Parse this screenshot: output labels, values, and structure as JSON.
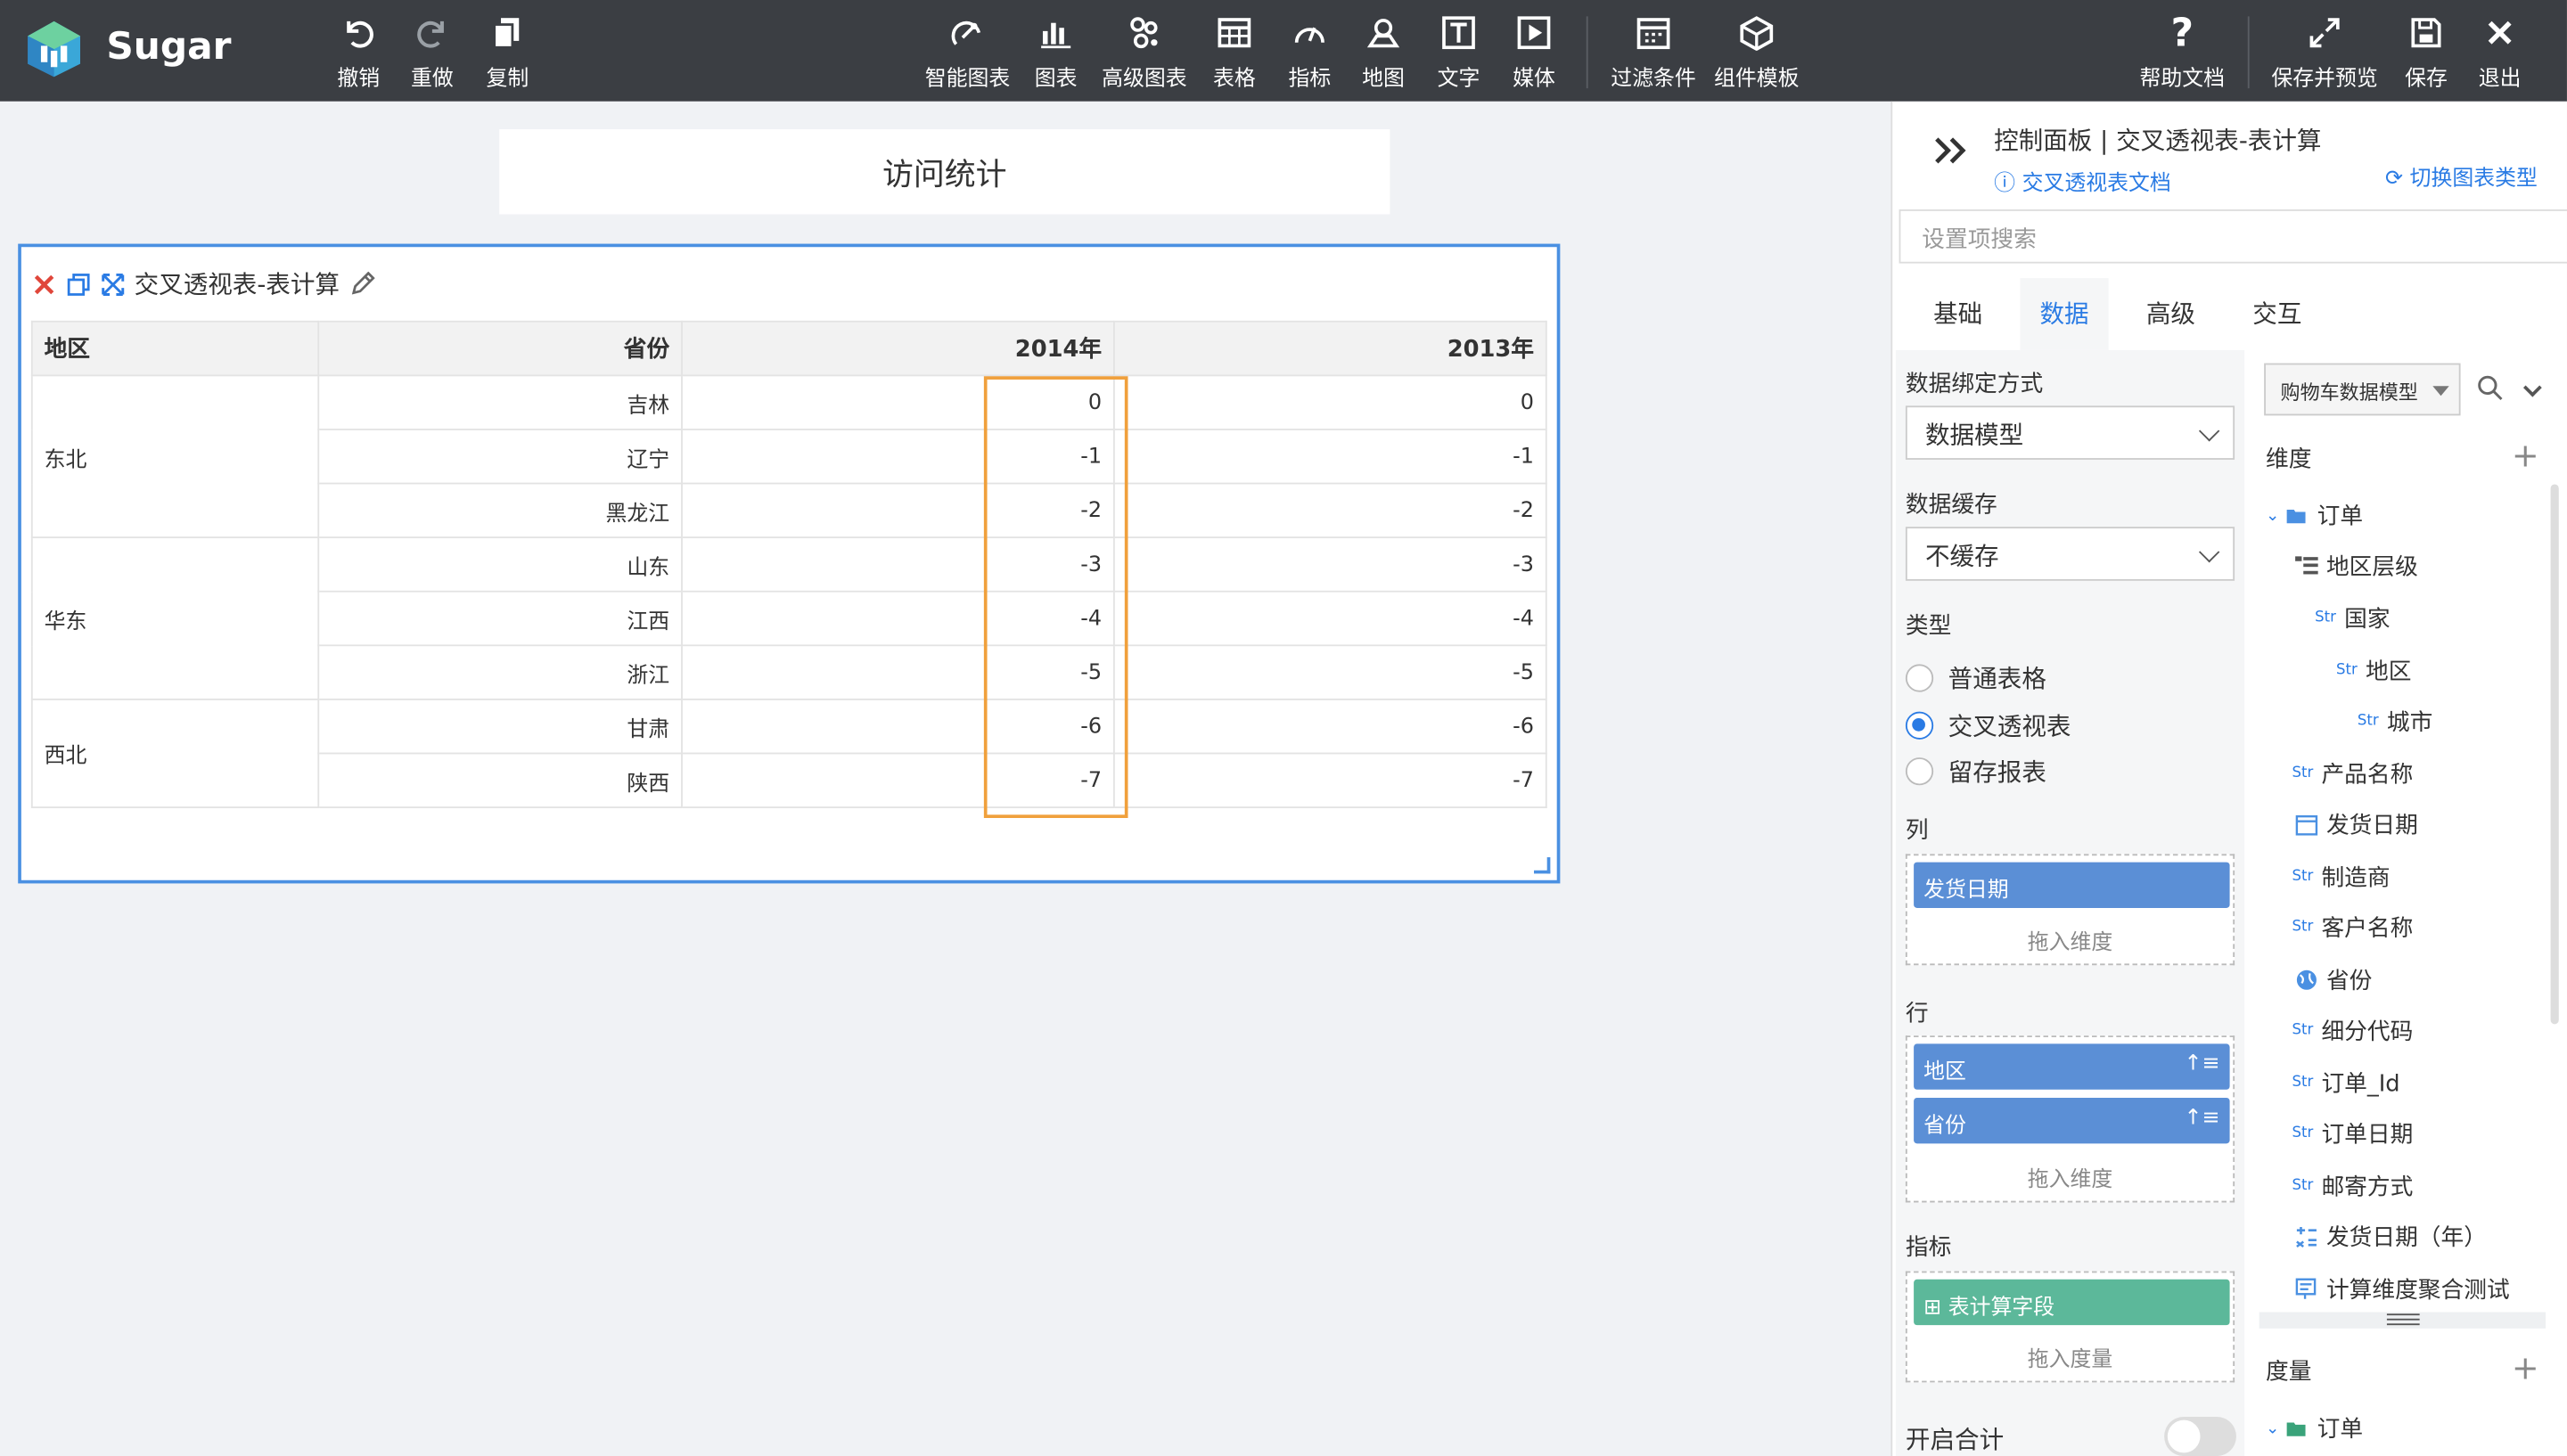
{
  "app": {
    "name": "Sugar"
  },
  "toolbar": {
    "undo": "撤销",
    "redo": "重做",
    "copy": "复制",
    "smart_chart": "智能图表",
    "chart": "图表",
    "adv_chart": "高级图表",
    "table": "表格",
    "indicator": "指标",
    "map": "地图",
    "text": "文字",
    "media": "媒体",
    "filter": "过滤条件",
    "template": "组件模板",
    "help": "帮助文档",
    "save_preview": "保存并预览",
    "save": "保存",
    "exit": "退出"
  },
  "canvas": {
    "page_title": "访问统计",
    "widget": {
      "title": "交叉透视表-表计算",
      "headers": [
        "地区",
        "省份",
        "2014年",
        "2013年"
      ],
      "regions": [
        {
          "name": "东北",
          "rows": [
            {
              "province": "吉林",
              "y2014": "0",
              "y2013": "0"
            },
            {
              "province": "辽宁",
              "y2014": "-1",
              "y2013": "-1"
            },
            {
              "province": "黑龙江",
              "y2014": "-2",
              "y2013": "-2"
            }
          ]
        },
        {
          "name": "华东",
          "rows": [
            {
              "province": "山东",
              "y2014": "-3",
              "y2013": "-3"
            },
            {
              "province": "江西",
              "y2014": "-4",
              "y2013": "-4"
            },
            {
              "province": "浙江",
              "y2014": "-5",
              "y2013": "-5"
            }
          ]
        },
        {
          "name": "西北",
          "rows": [
            {
              "province": "甘肃",
              "y2014": "-6",
              "y2013": "-6"
            },
            {
              "province": "陕西",
              "y2014": "-7",
              "y2013": "-7"
            }
          ]
        }
      ]
    }
  },
  "panel": {
    "title": "控制面板 | 交叉透视表-表计算",
    "doc_link": "交叉透视表文档",
    "switch_link": "切换图表类型",
    "search_placeholder": "设置项搜索",
    "tabs": [
      "基础",
      "数据",
      "高级",
      "交互"
    ],
    "binding_label": "数据绑定方式",
    "binding_value": "数据模型",
    "cache_label": "数据缓存",
    "cache_value": "不缓存",
    "type_label": "类型",
    "types": [
      "普通表格",
      "交叉透视表",
      "留存报表"
    ],
    "type_selected": "交叉透视表",
    "col_label": "列",
    "col_chip": "发货日期",
    "drop_dim": "拖入维度",
    "row_label": "行",
    "row_chips": [
      "地区",
      "省份"
    ],
    "metric_label": "指标",
    "metric_chip": "表计算字段",
    "drop_measure": "拖入度量",
    "total_label": "开启合计",
    "model_name": "购物车数据模型",
    "dimension_label": "维度",
    "measure_label": "度量",
    "str_tag": "Str",
    "tree": [
      {
        "label": "订单"
      },
      {
        "label": "地区层级"
      },
      {
        "label": "国家"
      },
      {
        "label": "地区"
      },
      {
        "label": "城市"
      },
      {
        "label": "产品名称"
      },
      {
        "label": "发货日期"
      },
      {
        "label": "制造商"
      },
      {
        "label": "客户名称"
      },
      {
        "label": "省份"
      },
      {
        "label": "细分代码"
      },
      {
        "label": "订单_Id"
      },
      {
        "label": "订单日期"
      },
      {
        "label": "邮寄方式"
      },
      {
        "label": "发货日期（年）"
      },
      {
        "label": "计算维度聚合测试"
      }
    ],
    "measure_tree": [
      {
        "label": "订单"
      }
    ]
  },
  "colors": {
    "accent": "#2a7be4",
    "chip_blue": "#5b8fd6",
    "chip_green": "#5cb89a",
    "highlight": "#f0a03c",
    "topbar": "#3b3e43"
  }
}
